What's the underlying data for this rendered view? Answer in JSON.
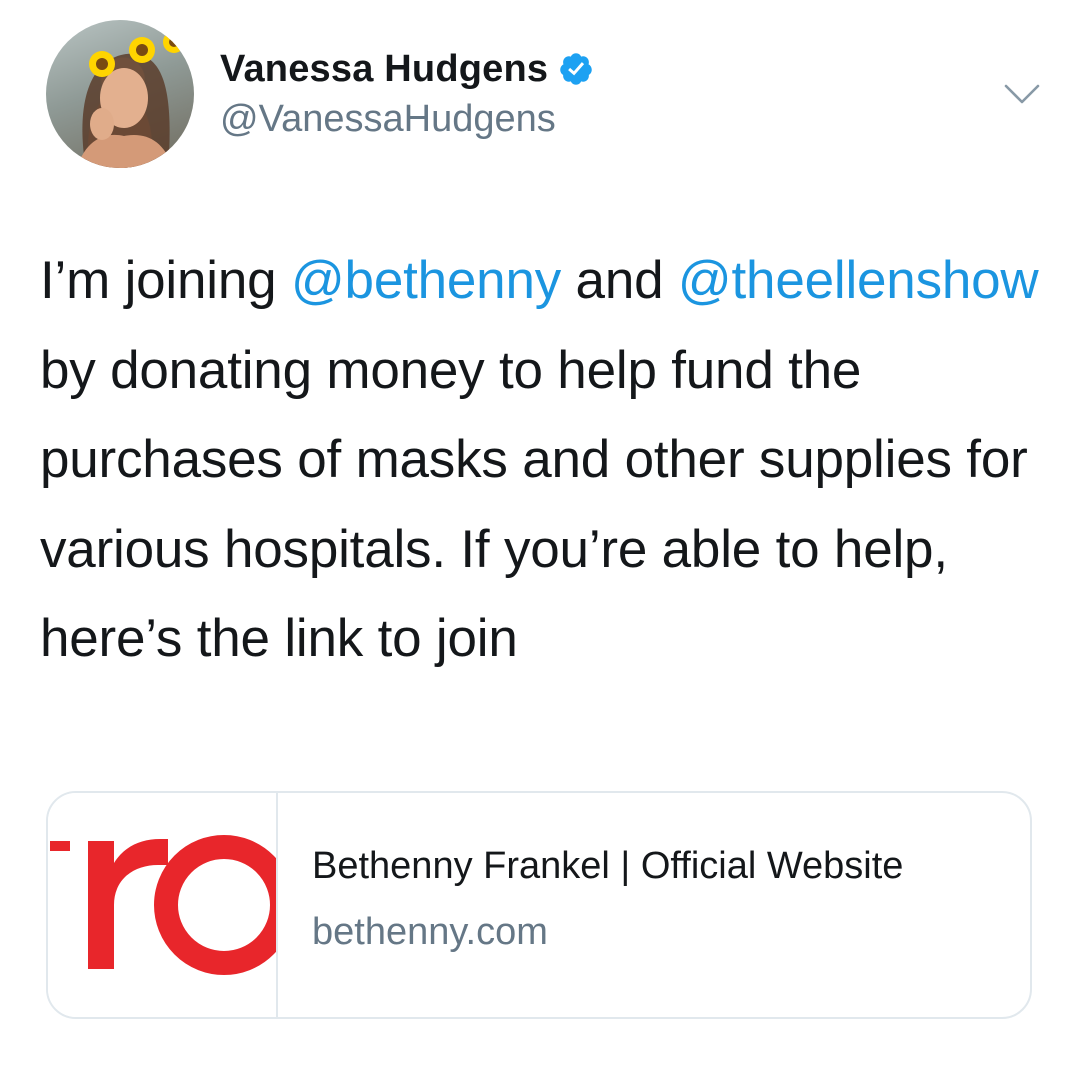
{
  "author": {
    "display_name": "Vanessa Hudgens",
    "handle": "@VanessaHudgens",
    "verified": true
  },
  "menu": {
    "icon": "chevron-down-icon"
  },
  "tweet": {
    "segments": [
      {
        "text": "I’m joining ",
        "type": "text"
      },
      {
        "text": "@bethenny",
        "type": "mention"
      },
      {
        "text": " and ",
        "type": "text"
      },
      {
        "text": "@theellenshow",
        "type": "mention"
      },
      {
        "text": " by donating money to help fund the purchases of masks and other supplies for various hospitals.  If you’re able to help, here’s the link to join",
        "type": "text"
      }
    ]
  },
  "link_card": {
    "thumbnail_text": "ro",
    "title": "Bethenny Frankel | Official Website",
    "domain": "bethenny.com"
  },
  "colors": {
    "mention": "#1b95e0",
    "verified_badge": "#1da1f2",
    "secondary_text": "#657786",
    "thumbnail_red": "#e8262b"
  }
}
